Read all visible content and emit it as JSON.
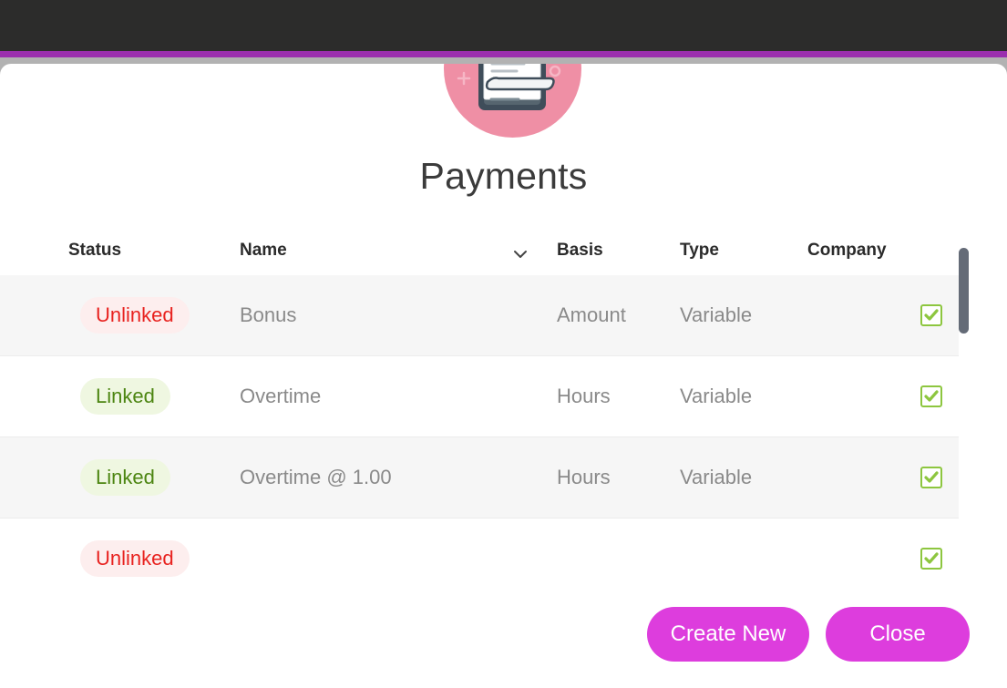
{
  "window": {
    "topbar_color": "#2c2c2b",
    "accent_color": "#9b2fae",
    "band_color": "#b2b2b2"
  },
  "modal": {
    "title": "Payments",
    "hero_icon": "clipboard-icon",
    "hero_circle_color": "#ef8fa5"
  },
  "table": {
    "columns": [
      {
        "key": "status",
        "label": "Status"
      },
      {
        "key": "name",
        "label": "Name",
        "sort_icon": "chevron-down-icon"
      },
      {
        "key": "basis",
        "label": "Basis"
      },
      {
        "key": "type",
        "label": "Type"
      },
      {
        "key": "company",
        "label": "Company"
      }
    ],
    "rows": [
      {
        "status": "Unlinked",
        "status_kind": "unlinked",
        "name": "Bonus",
        "basis": "Amount",
        "type": "Variable",
        "company": "",
        "checked": true
      },
      {
        "status": "Linked",
        "status_kind": "linked",
        "name": "Overtime",
        "basis": "Hours",
        "type": "Variable",
        "company": "",
        "checked": true
      },
      {
        "status": "Linked",
        "status_kind": "linked",
        "name": "Overtime @ 1.00",
        "basis": "Hours",
        "type": "Variable",
        "company": "",
        "checked": true
      },
      {
        "status": "Unlinked",
        "status_kind": "unlinked",
        "name": "",
        "basis": "",
        "type": "",
        "company": "",
        "checked": true
      }
    ],
    "badge_colors": {
      "unlinked_bg": "#fdeeee",
      "unlinked_fg": "#e8221f",
      "linked_bg": "#eff7e1",
      "linked_fg": "#4c8511"
    },
    "checkbox_color": "#8dc63f",
    "scrollbar_color": "#646b77"
  },
  "footer": {
    "create_label": "Create New",
    "close_label": "Close",
    "button_color": "#dd3ddd"
  }
}
